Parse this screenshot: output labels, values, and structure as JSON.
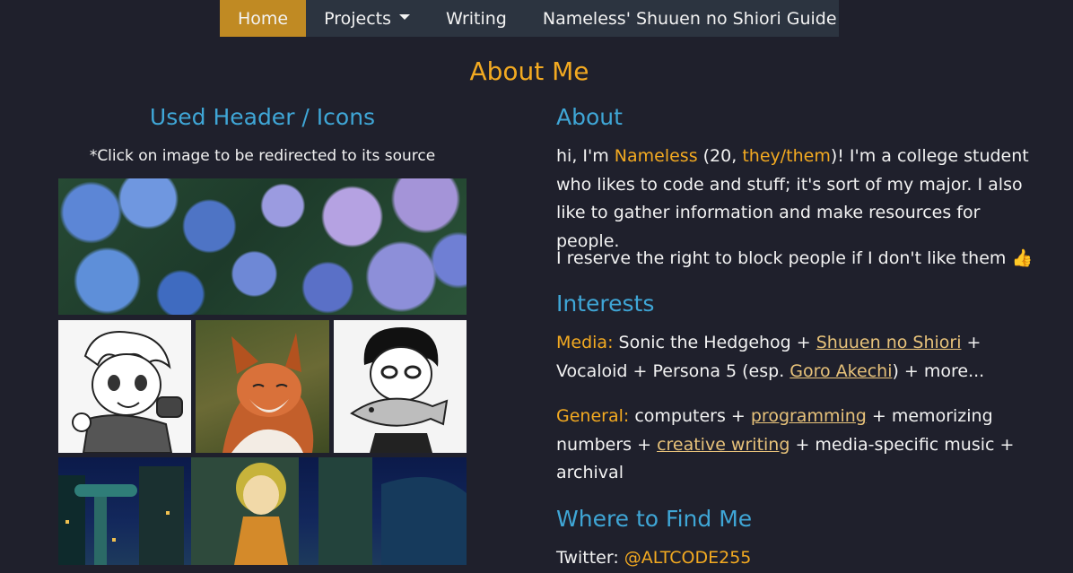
{
  "nav": {
    "items": [
      {
        "label": "Home",
        "active": true
      },
      {
        "label": "Projects",
        "dropdown": true
      },
      {
        "label": "Writing"
      },
      {
        "label": "Nameless' Shuuen no Shiori Guide"
      }
    ]
  },
  "page_title": "About Me",
  "left": {
    "heading": "Used Header / Icons",
    "note": "*Click on image to be redirected to its source"
  },
  "about": {
    "heading": "About",
    "p1": {
      "t1": "hi, I'm ",
      "name": "Nameless",
      "t2": " (20, ",
      "pronouns": "they/them",
      "t3": ")! I'm a college student who likes to code and stuff; it's sort of my major. I also like to gather information and make resources for people."
    },
    "p2": "I reserve the right to block people if I don't like them 👍"
  },
  "interests": {
    "heading": "Interests",
    "media": {
      "label": "Media:",
      "t1": " Sonic the Hedgehog + ",
      "link1": "Shuuen no Shiori",
      "t2": " + Vocaloid + Persona 5 (esp. ",
      "link2": "Goro Akechi",
      "t3": ") + more..."
    },
    "general": {
      "label": "General:",
      "t1": " computers + ",
      "link1": "programming",
      "t2": " + memorizing numbers + ",
      "link2": "creative writing",
      "t3": " + media-specific music + archival"
    }
  },
  "find": {
    "heading": "Where to Find Me",
    "twitter_label": "Twitter: ",
    "twitter_handle": "@ALTCODE255"
  },
  "colors": {
    "background": "#1f202c",
    "nav_bg": "#2c3440",
    "nav_active": "#c08a23",
    "accent_orange": "#f3aa21",
    "heading_blue": "#3fa6d6",
    "link_gold": "#e7c27a"
  }
}
